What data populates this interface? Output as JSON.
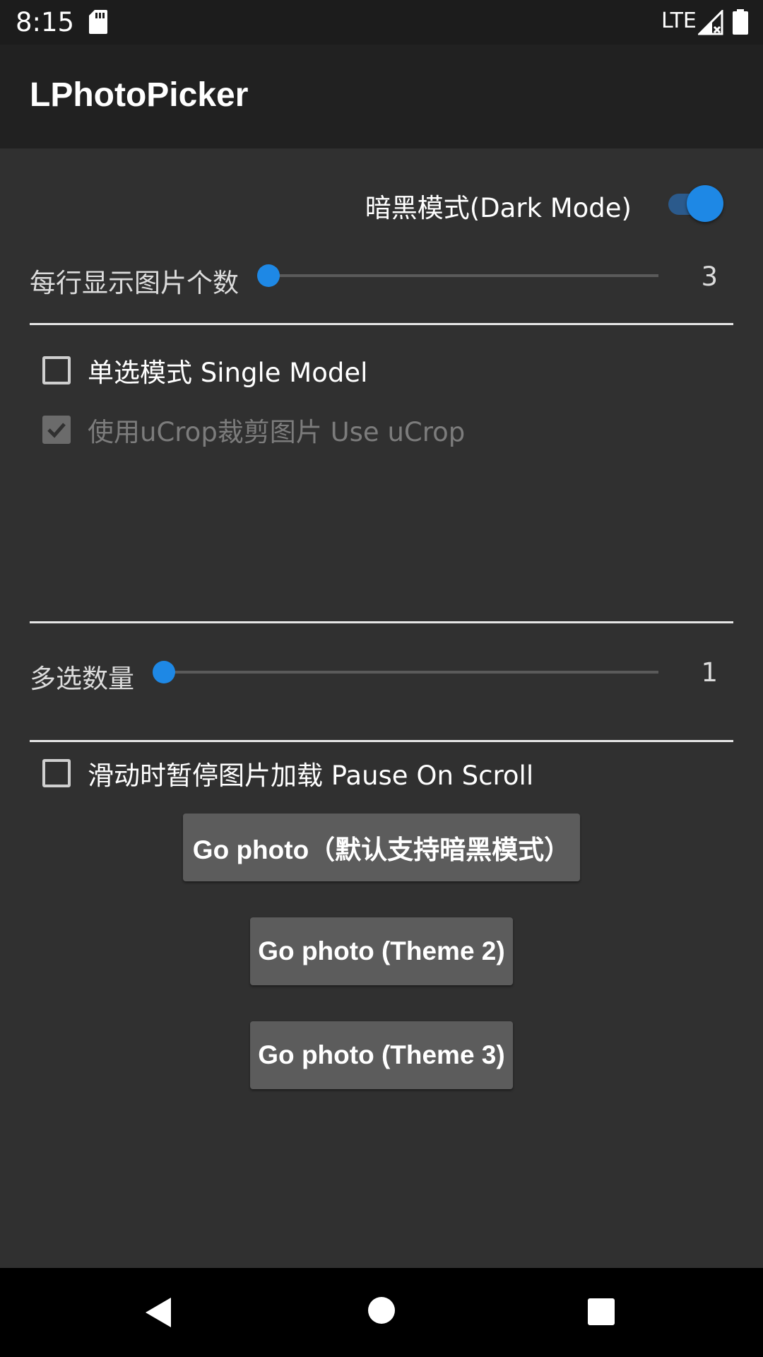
{
  "status_bar": {
    "time": "8:15",
    "network": "LTE",
    "icons": [
      "sd-card-icon",
      "signal-icon",
      "battery-icon"
    ]
  },
  "app_bar": {
    "title": "LPhotoPicker"
  },
  "dark_mode": {
    "label": "暗黑模式(Dark Mode)",
    "enabled": true
  },
  "columns_slider": {
    "label": "每行显示图片个数",
    "value": "3"
  },
  "options": {
    "single_mode": {
      "label": "单选模式 Single Model",
      "checked": false
    },
    "ucrop": {
      "label": "使用uCrop裁剪图片 Use uCrop",
      "checked": true,
      "enabled": false
    }
  },
  "max_select_slider": {
    "label": "多选数量",
    "value": "1"
  },
  "pause_on_scroll": {
    "label": "滑动时暂停图片加载 Pause On Scroll",
    "checked": false
  },
  "buttons": {
    "go_photo_default": "Go photo（默认支持暗黑模式）",
    "go_photo_theme2": "Go photo (Theme 2)",
    "go_photo_theme3": "Go photo (Theme 3)"
  },
  "colors": {
    "accent": "#1e88e5",
    "background": "#303030",
    "app_bar": "#212121",
    "button": "#5c5c5c"
  }
}
